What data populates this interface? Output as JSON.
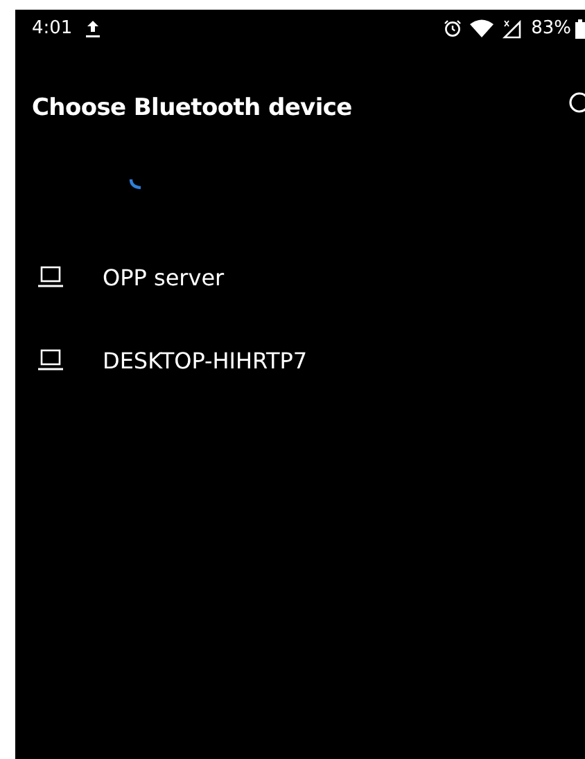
{
  "status_bar": {
    "time": "4:01",
    "battery": "83%"
  },
  "app_bar": {
    "title": "Choose Bluetooth device"
  },
  "devices": [
    {
      "name": "OPP server"
    },
    {
      "name": "DESKTOP-HIHRTP7"
    }
  ]
}
